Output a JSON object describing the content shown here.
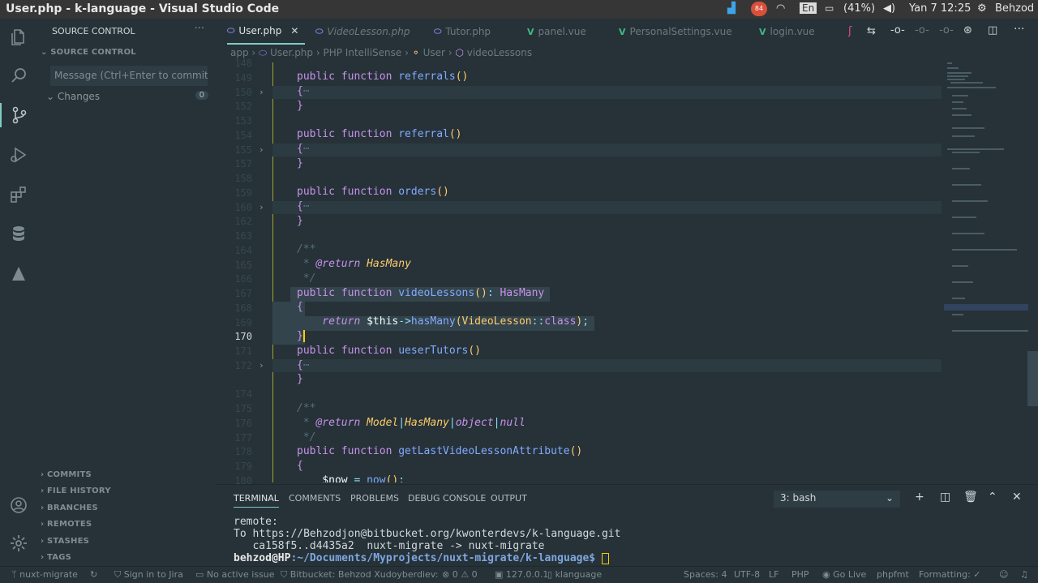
{
  "os": {
    "window_title": "User.php - k-language - Visual Studio Code",
    "badge": "84",
    "lang": "En",
    "battery": "(41%)",
    "datetime": "Yan  7 12:25",
    "user": "Behzod"
  },
  "sidebar": {
    "title": "SOURCE CONTROL",
    "section": "SOURCE CONTROL",
    "commit_placeholder": "Message (Ctrl+Enter to commit ...",
    "changes_label": "Changes",
    "changes_count": "0",
    "sections": [
      "COMMITS",
      "FILE HISTORY",
      "BRANCHES",
      "REMOTES",
      "STASHES",
      "TAGS"
    ]
  },
  "tabs": [
    {
      "label": "User.php",
      "icon": "php",
      "active": true
    },
    {
      "label": "VideoLesson.php",
      "icon": "php"
    },
    {
      "label": "Tutor.php",
      "icon": "php"
    },
    {
      "label": "panel.vue",
      "icon": "vue"
    },
    {
      "label": "PersonalSettings.vue",
      "icon": "vue"
    },
    {
      "label": "login.vue",
      "icon": "vue"
    }
  ],
  "breadcrumb": [
    "app",
    "User.php",
    "PHP IntelliSense",
    "User",
    "videoLessons"
  ],
  "editor": {
    "line_numbers": [
      "148",
      "149",
      "150",
      "152",
      "153",
      "154",
      "155",
      "157",
      "158",
      "159",
      "160",
      "162",
      "163",
      "164",
      "165",
      "166",
      "167",
      "168",
      "169",
      "170",
      "171",
      "172",
      "174",
      "175",
      "176",
      "177",
      "178",
      "179",
      "180",
      "181"
    ]
  },
  "panel": {
    "tabs": [
      "TERMINAL",
      "COMMENTS",
      "PROBLEMS",
      "DEBUG CONSOLE",
      "OUTPUT"
    ],
    "shell": "3: bash",
    "terminal_lines": [
      "remote:",
      "To https://Behzodjon@bitbucket.org/kwonterdevs/k-language.git",
      "   ca158f5..d4435a2  nuxt-migrate -> nuxt-migrate"
    ],
    "prompt_user": "behzod@HP",
    "prompt_path": ":~/Documents/Myprojects/nuxt-migrate/k-language$"
  },
  "status": {
    "branch": "nuxt-migrate",
    "sign_in": "Sign in to Jira",
    "issue": "No active issue",
    "bitbucket": "Bitbucket: Behzod Xudoyberdiev:",
    "errors": "0",
    "warnings": "0",
    "server": "127.0.0.1",
    "db": "klanguage",
    "spaces": "Spaces: 4",
    "encoding": "UTF-8",
    "eol": "LF",
    "language": "PHP",
    "golive": "Go Live",
    "phpfmt": "phpfmt",
    "formatting": "Formatting: ✓"
  }
}
